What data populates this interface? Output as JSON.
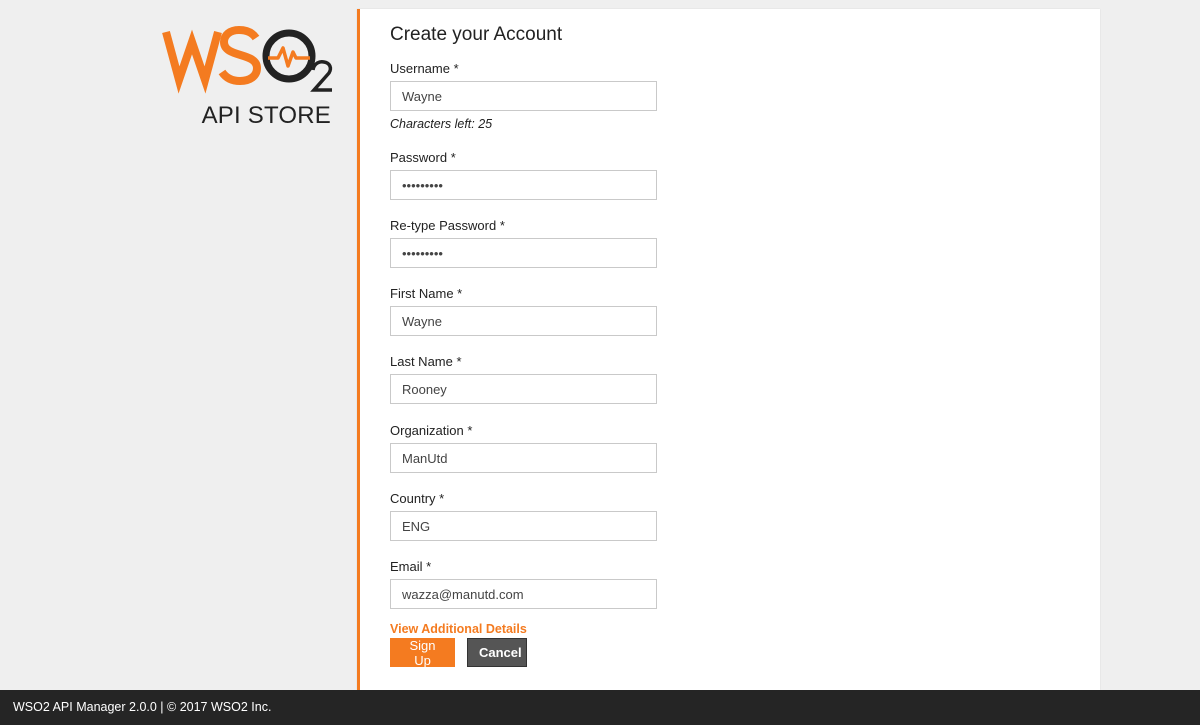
{
  "brand": {
    "logo_text": "WSO2",
    "subtitle": "API STORE",
    "accent_color": "#f47b20"
  },
  "form": {
    "title": "Create your Account",
    "username": {
      "label": "Username *",
      "value": "Wayne",
      "hint": "Characters left: 25"
    },
    "password": {
      "label": "Password *",
      "value": "•••••••••"
    },
    "retype_password": {
      "label": "Re-type Password *",
      "value": "•••••••••"
    },
    "first_name": {
      "label": "First Name *",
      "value": "Wayne"
    },
    "last_name": {
      "label": "Last Name *",
      "value": "Rooney"
    },
    "organization": {
      "label": "Organization *",
      "value": "ManUtd"
    },
    "country": {
      "label": "Country *",
      "value": "ENG"
    },
    "email": {
      "label": "Email *",
      "value": "wazza@manutd.com"
    },
    "additional_details_link": "View Additional Details",
    "signup_label": "Sign Up",
    "cancel_label": "Cancel"
  },
  "footer": {
    "text": "WSO2 API Manager 2.0.0 | © 2017 WSO2 Inc."
  }
}
